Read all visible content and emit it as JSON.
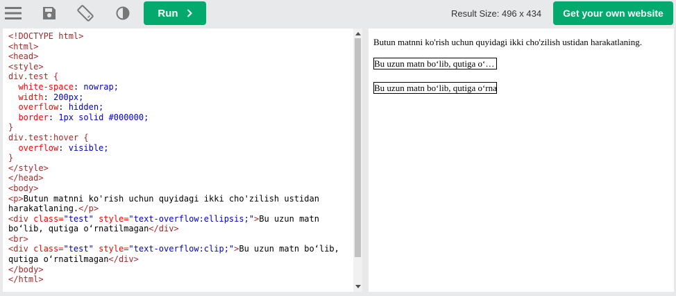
{
  "toolbar": {
    "icons": [
      "menu-icon",
      "save-icon",
      "rotate-icon",
      "contrast-icon"
    ],
    "run_label": "Run",
    "result_size": "Result Size: 496 x 434",
    "get_website_label": "Get your own website"
  },
  "editor": {
    "lines": [
      "<!DOCTYPE html>",
      "<html>",
      "<head>",
      "<style>",
      "div.test {",
      "  white-space: nowrap;",
      "  width: 200px;",
      "  overflow: hidden;",
      "  border: 1px solid #000000;",
      "}",
      "div.test:hover {",
      "  overflow: visible;",
      "}",
      "</style>",
      "</head>",
      "<body>",
      "<p>Butun matnni ko'rish uchun quyidagi ikki cho'zilish ustidan",
      "harakatlaning.</p>",
      "<div class=\"test\" style=\"text-overflow:ellipsis;\">Bu uzun matn",
      "bo‘lib, qutiga o‘rnatilmagan</div>",
      "<br>",
      "<div class=\"test\" style=\"text-overflow:clip;\">Bu uzun matn bo‘lib,",
      "qutiga o‘rnatilmagan</div>",
      "</body>",
      "</html>"
    ]
  },
  "result": {
    "paragraph": "Butun matnni ko'rish uchun quyidagi ikki cho'zilish ustidan harakatlaning.",
    "box1": "Bu uzun matn bo‘lib, qutiga o‘rnatilmagan",
    "box2": "Bu uzun matn bo‘lib, qutiga o‘rnatilmagan"
  },
  "colors": {
    "accent": "#04aa6d",
    "toolbar_bg": "#e7e9eb"
  }
}
